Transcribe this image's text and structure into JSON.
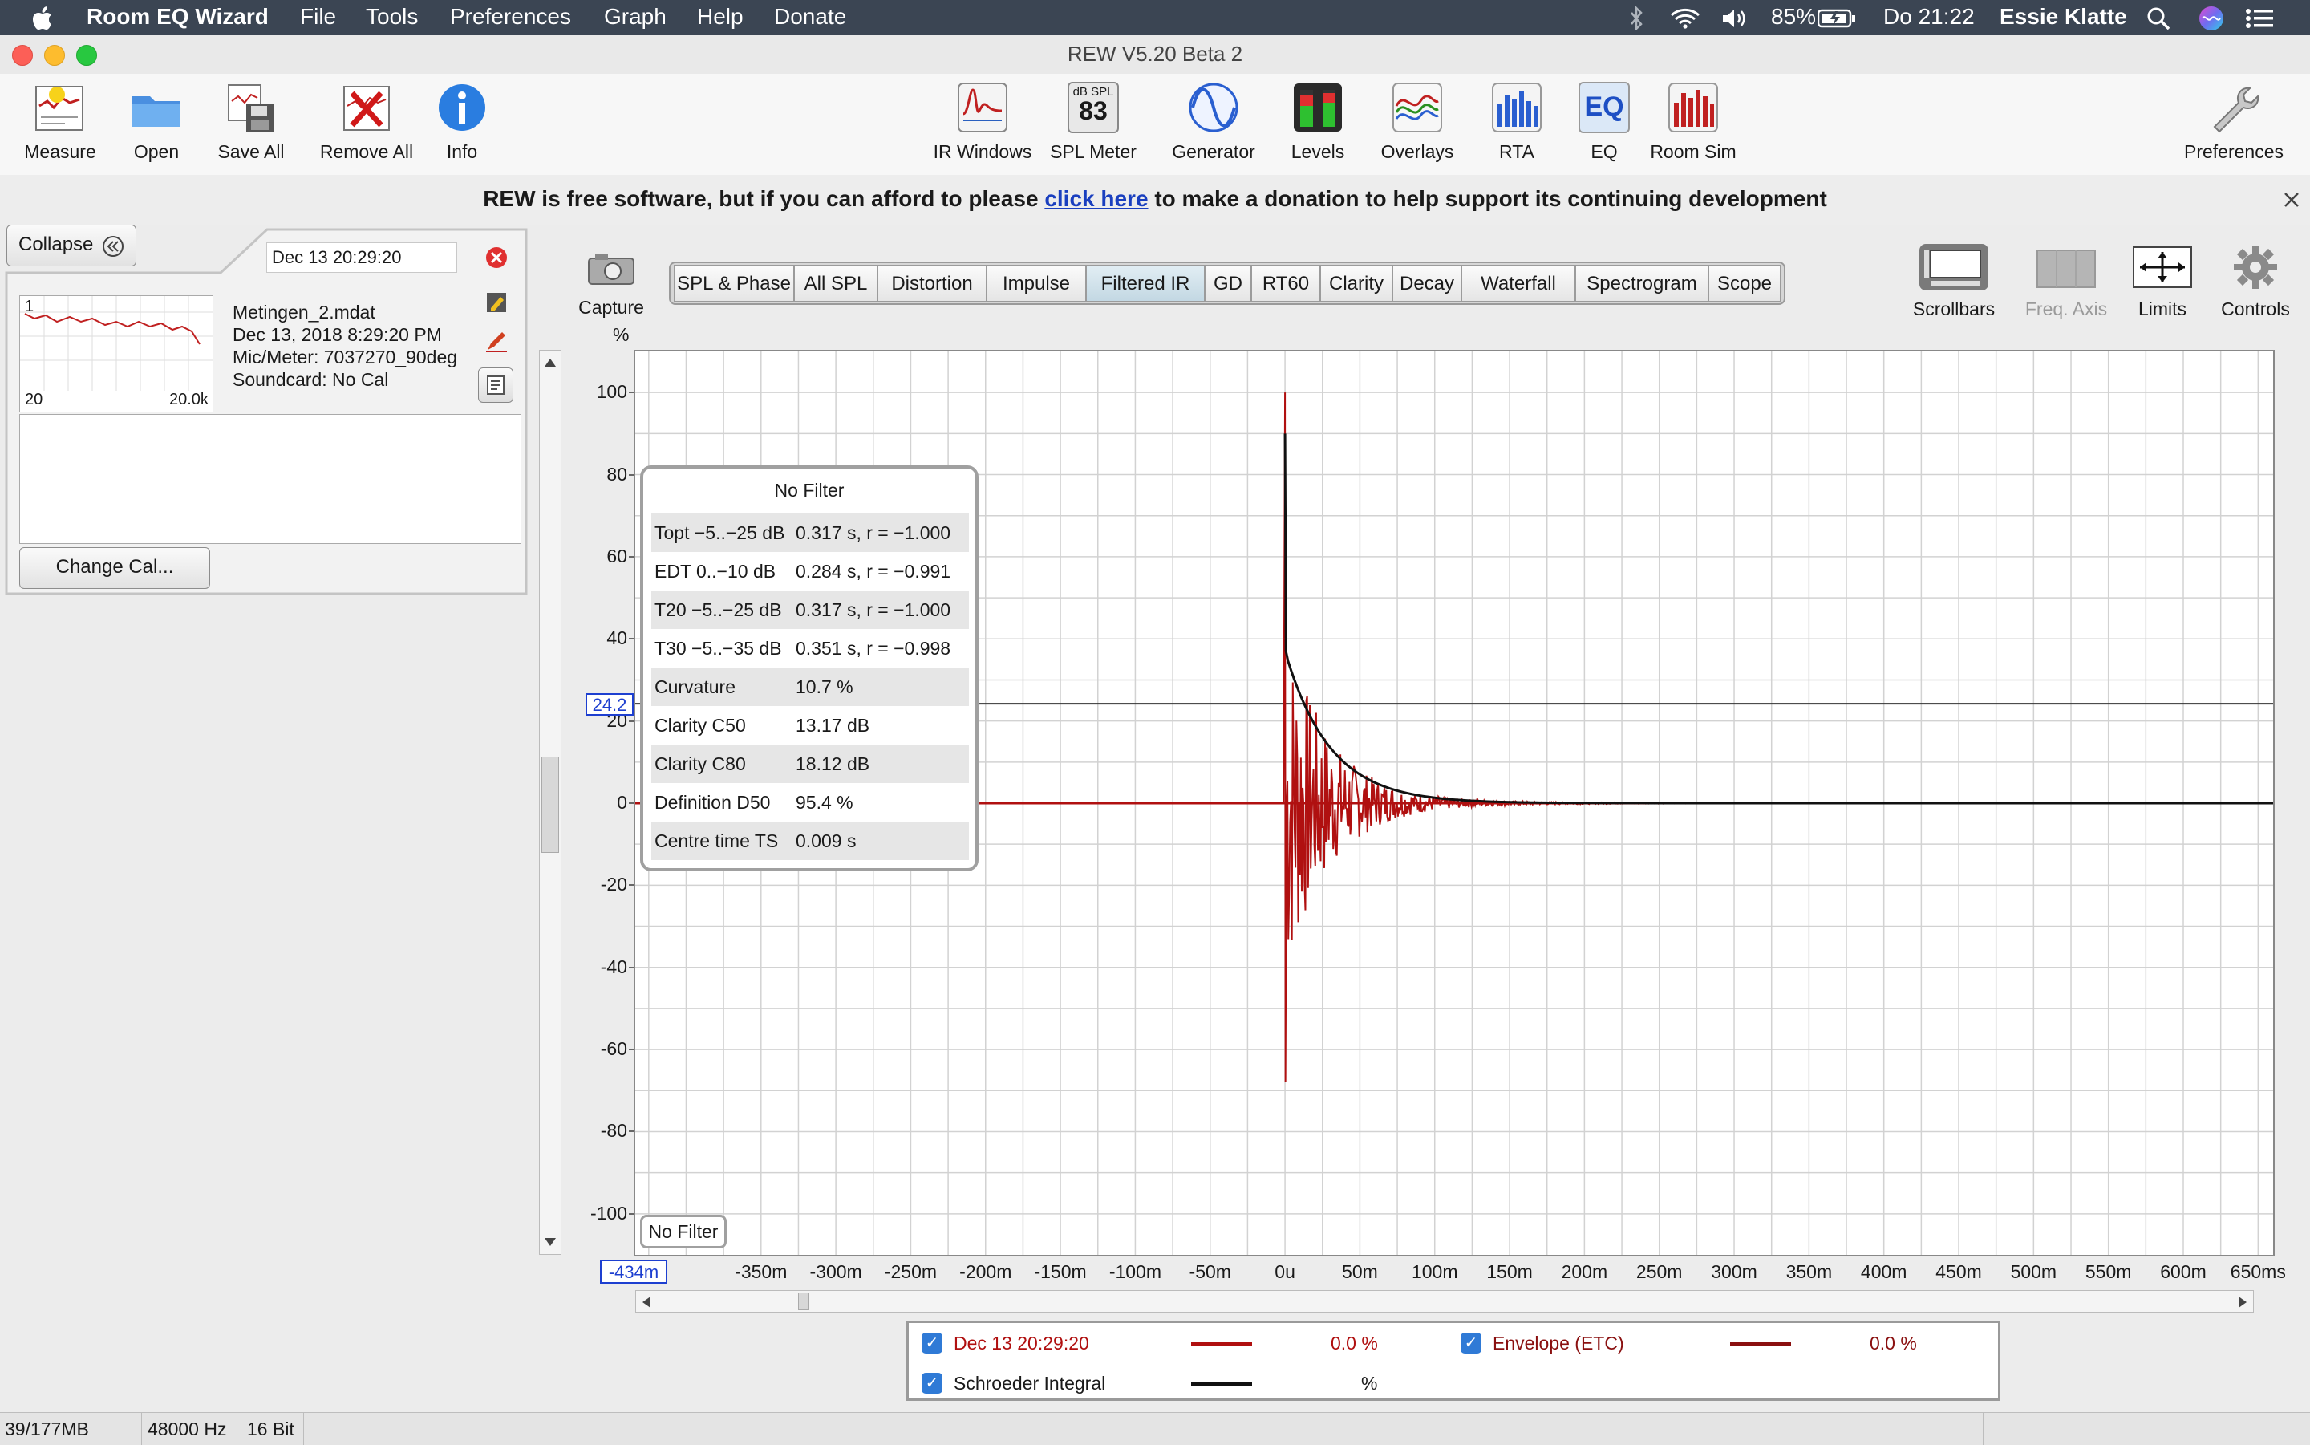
{
  "menubar": {
    "app_name": "Room EQ Wizard",
    "menus": [
      "File",
      "Tools",
      "Preferences",
      "Graph",
      "Help",
      "Donate"
    ],
    "battery": "85%",
    "clock": "Do 21:22",
    "user": "Essie Klatte"
  },
  "window": {
    "title": "REW V5.20 Beta 2"
  },
  "toolbar": {
    "left": [
      "Measure",
      "Open",
      "Save All",
      "Remove All",
      "Info"
    ],
    "center": [
      "IR Windows",
      "SPL Meter",
      "Generator",
      "Levels",
      "Overlays",
      "RTA",
      "EQ",
      "Room Sim"
    ],
    "spl_unit": "dB SPL",
    "spl_value": "83",
    "eq_icon_text": "EQ",
    "right": "Preferences"
  },
  "donation": {
    "before": "REW is free software, but if you can afford to please",
    "link": "click here",
    "after": "to make a donation to help support its continuing development"
  },
  "left_panel": {
    "collapse_label": "Collapse",
    "selected_measurement": "Dec 13 20:29:20",
    "measurement": {
      "index": "1",
      "thumb_min": "20",
      "thumb_max": "20.0k",
      "name": "Metingen_2.mdat",
      "date": "Dec 13, 2018 8:29:20 PM",
      "mic": "Mic/Meter: 7037270_90deg",
      "soundcard": "Soundcard: No Cal"
    },
    "change_cal_label": "Change Cal..."
  },
  "graph": {
    "capture_label": "Capture",
    "tabs": [
      "SPL & Phase",
      "All SPL",
      "Distortion",
      "Impulse",
      "Filtered IR",
      "GD",
      "RT60",
      "Clarity",
      "Decay",
      "Waterfall",
      "Spectrogram",
      "Scope"
    ],
    "active_tab": "Filtered IR",
    "right_tools": [
      "Scrollbars",
      "Freq. Axis",
      "Limits",
      "Controls"
    ],
    "y_unit": "%",
    "cursor_y": "24.2",
    "cursor_x": "-434m",
    "filter_label": "No Filter"
  },
  "results": {
    "title": "No Filter",
    "rows": [
      {
        "k": "Topt −5..−25 dB",
        "v": "0.317 s,  r = −1.000"
      },
      {
        "k": "EDT  0..−10 dB",
        "v": "0.284 s,  r = −0.991"
      },
      {
        "k": "T20 −5..−25 dB",
        "v": "0.317 s,  r = −1.000"
      },
      {
        "k": "T30 −5..−35 dB",
        "v": "0.351 s,  r = −0.998"
      },
      {
        "k": "Curvature",
        "v": "10.7 %"
      },
      {
        "k": "Clarity C50",
        "v": "13.17 dB"
      },
      {
        "k": "Clarity C80",
        "v": "18.12 dB"
      },
      {
        "k": "Definition D50",
        "v": "95.4 %"
      },
      {
        "k": "Centre time TS",
        "v": "0.009 s"
      }
    ]
  },
  "legend": {
    "items": [
      {
        "name": "Dec 13 20:29:20",
        "value": "0.0 %",
        "color": "#b01010"
      },
      {
        "name": "Envelope (ETC)",
        "value": "0.0 %",
        "color": "#8a1010"
      },
      {
        "name": "Schroeder Integral",
        "value": "%",
        "color": "#111111"
      }
    ]
  },
  "status": {
    "memory": "39/177MB",
    "rate": "48000 Hz",
    "bits": "16 Bit"
  },
  "chart_data": {
    "type": "line",
    "ylabel": "%",
    "ylim": [
      -110,
      110
    ],
    "yticks": [
      100,
      80,
      60,
      40,
      20,
      0,
      -20,
      -40,
      -60,
      -80,
      -100
    ],
    "xlim": [
      -0.434,
      0.66
    ],
    "xticks": [
      "-350m",
      "-300m",
      "-250m",
      "-200m",
      "-150m",
      "-100m",
      "-50m",
      "0u",
      "50m",
      "100m",
      "150m",
      "200m",
      "250m",
      "300m",
      "350m",
      "400m",
      "450m",
      "500m",
      "550m",
      "600m",
      "650ms"
    ],
    "xtick_values": [
      -0.35,
      -0.3,
      -0.25,
      -0.2,
      -0.15,
      -0.1,
      -0.05,
      0,
      0.05,
      0.1,
      0.15,
      0.2,
      0.25,
      0.3,
      0.35,
      0.4,
      0.45,
      0.5,
      0.55,
      0.6,
      0.65
    ],
    "cursor_y": 24.2,
    "series": [
      {
        "name": "Dec 13 20:29:20",
        "color": "#b01010",
        "peak": 100,
        "trough": -68
      },
      {
        "name": "Schroeder Integral",
        "color": "#111111",
        "peak": 90,
        "decay_time": 0.02
      }
    ]
  }
}
